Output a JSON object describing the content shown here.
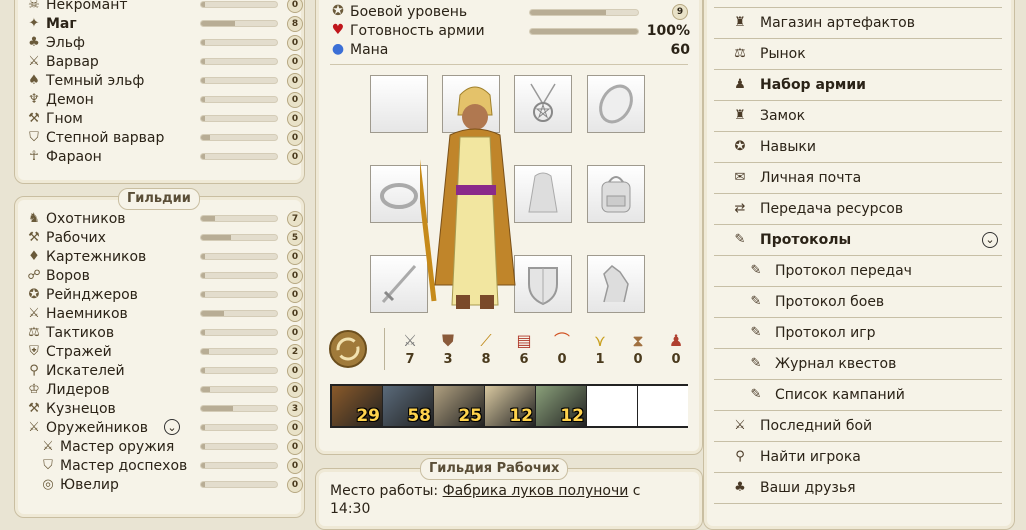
{
  "left": {
    "races": [
      {
        "icon": "necromancer-icon",
        "glyph": "☠",
        "label": "Некромант",
        "bold": false,
        "fill": 0.05,
        "value": "0"
      },
      {
        "icon": "mage-icon",
        "glyph": "✦",
        "label": "Маг",
        "bold": true,
        "fill": 0.45,
        "value": "8"
      },
      {
        "icon": "elf-icon",
        "glyph": "♣",
        "label": "Эльф",
        "bold": false,
        "fill": 0.05,
        "value": "0"
      },
      {
        "icon": "barbarian-icon",
        "glyph": "⚔",
        "label": "Варвар",
        "bold": false,
        "fill": 0.05,
        "value": "0"
      },
      {
        "icon": "dark-elf-icon",
        "glyph": "♠",
        "label": "Темный эльф",
        "bold": false,
        "fill": 0.05,
        "value": "0"
      },
      {
        "icon": "demon-icon",
        "glyph": "♆",
        "label": "Демон",
        "bold": false,
        "fill": 0.05,
        "value": "0"
      },
      {
        "icon": "dwarf-icon",
        "glyph": "⚒",
        "label": "Гном",
        "bold": false,
        "fill": 0.05,
        "value": "0"
      },
      {
        "icon": "steppe-barbarian-icon",
        "glyph": "⛉",
        "label": "Степной варвар",
        "bold": false,
        "fill": 0.12,
        "value": "0"
      },
      {
        "icon": "pharaoh-icon",
        "glyph": "☥",
        "label": "Фараон",
        "bold": false,
        "fill": 0.05,
        "value": "0"
      }
    ],
    "guilds_title": "Гильдии",
    "guilds": [
      {
        "icon": "hunters-guild-icon",
        "glyph": "♞",
        "label": "Охотников",
        "sub": false,
        "fill": 0.18,
        "value": "7"
      },
      {
        "icon": "workers-guild-icon",
        "glyph": "⚒",
        "label": "Рабочих",
        "sub": false,
        "fill": 0.4,
        "value": "5"
      },
      {
        "icon": "gamblers-guild-icon",
        "glyph": "♦",
        "label": "Картежников",
        "sub": false,
        "fill": 0.05,
        "value": "0"
      },
      {
        "icon": "thieves-guild-icon",
        "glyph": "☍",
        "label": "Воров",
        "sub": false,
        "fill": 0.05,
        "value": "0"
      },
      {
        "icon": "rangers-guild-icon",
        "glyph": "✪",
        "label": "Рейнджеров",
        "sub": false,
        "fill": 0.05,
        "value": "0"
      },
      {
        "icon": "mercenaries-guild-icon",
        "glyph": "⚔",
        "label": "Наемников",
        "sub": false,
        "fill": 0.3,
        "value": "0"
      },
      {
        "icon": "tactics-guild-icon",
        "glyph": "⚖",
        "label": "Тактиков",
        "sub": false,
        "fill": 0.05,
        "value": "0"
      },
      {
        "icon": "guards-guild-icon",
        "glyph": "⛨",
        "label": "Стражей",
        "sub": false,
        "fill": 0.1,
        "value": "2"
      },
      {
        "icon": "seekers-guild-icon",
        "glyph": "⚲",
        "label": "Искателей",
        "sub": false,
        "fill": 0.05,
        "value": "0"
      },
      {
        "icon": "leaders-guild-icon",
        "glyph": "♔",
        "label": "Лидеров",
        "sub": false,
        "fill": 0.12,
        "value": "0"
      },
      {
        "icon": "smiths-guild-icon",
        "glyph": "⚒",
        "label": "Кузнецов",
        "sub": false,
        "fill": 0.42,
        "value": "3"
      },
      {
        "icon": "gunsmiths-guild-icon",
        "glyph": "⚔",
        "label": "Оружейников",
        "sub": false,
        "fill": 0.05,
        "value": "0",
        "expand": "⌄"
      },
      {
        "icon": "weapon-master-icon",
        "glyph": "⚔",
        "label": "Мастер оружия",
        "sub": true,
        "fill": 0.05,
        "value": "0"
      },
      {
        "icon": "armor-master-icon",
        "glyph": "⛉",
        "label": "Мастер доспехов",
        "sub": true,
        "fill": 0.05,
        "value": "0"
      },
      {
        "icon": "jeweler-icon",
        "glyph": "◎",
        "label": "Ювелир",
        "sub": true,
        "fill": 0.05,
        "value": "0"
      }
    ]
  },
  "middle": {
    "stats": [
      {
        "icon": "combat-level-icon",
        "glyph": "✪",
        "label": "Боевой уровень",
        "value": "9",
        "bar": true,
        "fill": 0.7,
        "badge": true,
        "color": "#6b5a3a"
      },
      {
        "icon": "army-readiness-icon",
        "glyph": "♥",
        "label": "Готовность армии",
        "value": "100%",
        "bar": true,
        "fill": 1.0,
        "badge": false,
        "color": "#c0161c"
      },
      {
        "icon": "mana-icon",
        "glyph": "●",
        "label": "Мана",
        "value": "60",
        "bar": false,
        "badge": false,
        "color": "#3b6fd6"
      }
    ],
    "counters": [
      {
        "icon": "swords-icon",
        "glyph": "⚔",
        "value": "7",
        "color": "#7a7a7a"
      },
      {
        "icon": "shield-icon",
        "glyph": "⛊",
        "value": "3",
        "color": "#8a5a3a"
      },
      {
        "icon": "wand-icon",
        "glyph": "⟋",
        "value": "8",
        "color": "#c08a1a"
      },
      {
        "icon": "spellbook-icon",
        "glyph": "▤",
        "value": "6",
        "color": "#b03a2a"
      },
      {
        "icon": "rainbow-icon",
        "glyph": "⌒",
        "value": "0",
        "color": "#d05020"
      },
      {
        "icon": "wings-icon",
        "glyph": "⋎",
        "value": "1",
        "color": "#c9a020"
      },
      {
        "icon": "hourglass-icon",
        "glyph": "⧗",
        "value": "0",
        "color": "#a07040"
      },
      {
        "icon": "figure-icon",
        "glyph": "♟",
        "value": "0",
        "color": "#b04030"
      }
    ],
    "army": [
      {
        "name": "army-unit-1",
        "value": "29",
        "color": "#8a5a2a"
      },
      {
        "name": "army-unit-2",
        "value": "58",
        "color": "#5a6a7a"
      },
      {
        "name": "army-unit-3",
        "value": "25",
        "color": "#b0a080"
      },
      {
        "name": "army-unit-4",
        "value": "12",
        "color": "#d8c8a0"
      },
      {
        "name": "army-unit-5",
        "value": "12",
        "color": "#8aa07a"
      },
      {
        "name": "army-slot-empty-1",
        "value": ""
      },
      {
        "name": "army-slot-empty-2",
        "value": ""
      }
    ],
    "workers_guild_title": "Гильдия Рабочих",
    "workplace_label": "Место работы:",
    "workplace_link": "Фабрика луков полуночи",
    "workplace_suffix": "с",
    "workplace_time": "14:30"
  },
  "nav": {
    "items": [
      {
        "icon": "artifact-shop-icon",
        "glyph": "♜",
        "label": "Магазин артефактов",
        "sub": false,
        "bold": false
      },
      {
        "icon": "market-icon",
        "glyph": "⚖",
        "label": "Рынок",
        "sub": false,
        "bold": false
      },
      {
        "icon": "army-recruit-icon",
        "glyph": "♟",
        "label": "Набор армии",
        "sub": false,
        "bold": true
      },
      {
        "icon": "castle-icon",
        "glyph": "♜",
        "label": "Замок",
        "sub": false,
        "bold": false
      },
      {
        "icon": "skills-icon",
        "glyph": "✪",
        "label": "Навыки",
        "sub": false,
        "bold": false
      },
      {
        "icon": "mail-icon",
        "glyph": "✉",
        "label": "Личная почта",
        "sub": false,
        "bold": false
      },
      {
        "icon": "resource-transfer-icon",
        "glyph": "⇄",
        "label": "Передача ресурсов",
        "sub": false,
        "bold": false
      },
      {
        "icon": "protocols-icon",
        "glyph": "✎",
        "label": "Протоколы",
        "sub": false,
        "bold": true,
        "expand": "⌄"
      },
      {
        "icon": "transfer-log-icon",
        "glyph": "✎",
        "label": "Протокол передач",
        "sub": true,
        "bold": false
      },
      {
        "icon": "battle-log-icon",
        "glyph": "✎",
        "label": "Протокол боев",
        "sub": true,
        "bold": false
      },
      {
        "icon": "game-log-icon",
        "glyph": "✎",
        "label": "Протокол игр",
        "sub": true,
        "bold": false
      },
      {
        "icon": "quest-log-icon",
        "glyph": "✎",
        "label": "Журнал квестов",
        "sub": true,
        "bold": false
      },
      {
        "icon": "campaign-list-icon",
        "glyph": "✎",
        "label": "Список кампаний",
        "sub": true,
        "bold": false
      },
      {
        "icon": "last-battle-icon",
        "glyph": "⚔",
        "label": "Последний бой",
        "sub": false,
        "bold": false
      },
      {
        "icon": "find-player-icon",
        "glyph": "⚲",
        "label": "Найти игрока",
        "sub": false,
        "bold": false
      },
      {
        "icon": "friends-icon",
        "glyph": "♣",
        "label": "Ваши друзья",
        "sub": false,
        "bold": false
      }
    ]
  }
}
